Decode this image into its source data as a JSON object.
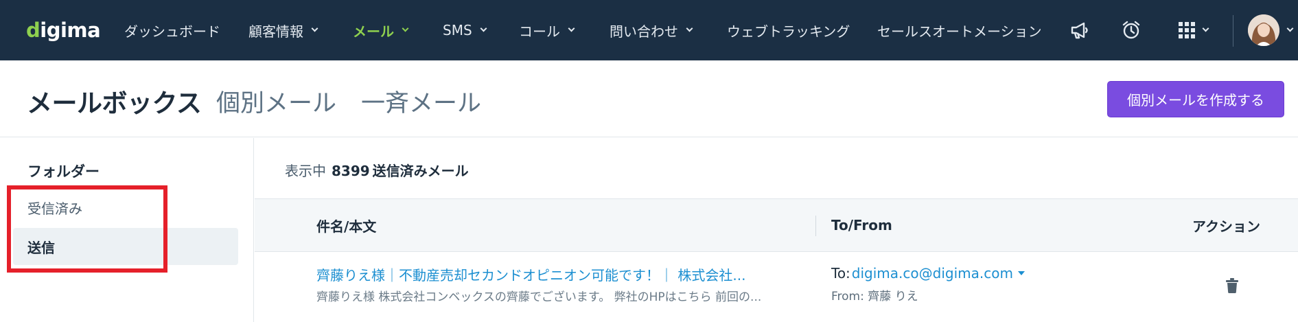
{
  "app": {
    "logo_text": "digima",
    "brand_color": "#8fd14f",
    "nav_background": "#1b2f44"
  },
  "nav": {
    "items": [
      {
        "label": "ダッシュボード",
        "has_dropdown": false,
        "active": false
      },
      {
        "label": "顧客情報",
        "has_dropdown": true,
        "active": false
      },
      {
        "label": "メール",
        "has_dropdown": true,
        "active": true
      },
      {
        "label": "SMS",
        "has_dropdown": true,
        "active": false
      },
      {
        "label": "コール",
        "has_dropdown": true,
        "active": false
      },
      {
        "label": "問い合わせ",
        "has_dropdown": true,
        "active": false
      },
      {
        "label": "ウェブトラッキング",
        "has_dropdown": false,
        "active": false
      },
      {
        "label": "セールスオートメーション",
        "has_dropdown": false,
        "active": false
      }
    ],
    "icons": [
      "megaphone-icon",
      "alarm-clock-icon",
      "apps-grid-icon",
      "user-avatar"
    ]
  },
  "header": {
    "title": "メールボックス",
    "tabs": [
      "個別メール",
      "一斉メール"
    ],
    "compose_button": "個別メールを作成する",
    "compose_button_color": "#7a4ce0"
  },
  "sidebar": {
    "heading": "フォルダー",
    "folders": [
      {
        "label": "受信済み",
        "selected": false
      },
      {
        "label": "送信",
        "selected": true
      }
    ],
    "highlight_color": "#e5202a"
  },
  "list": {
    "count_prefix": "表示中",
    "count": "8399",
    "count_label": "送信済みメール",
    "columns": [
      "件名/本文",
      "To/From",
      "アクション"
    ],
    "rows": [
      {
        "subject": "齊藤りえ様｜不動産売却セカンドオピニオン可能です！｜ 株式会社...",
        "snippet": "齊藤りえ様 株式会社コンベックスの齊藤でございます。 弊社のHPはこちら 前回の...",
        "to_prefix": "To:",
        "to": "digima.co@digima.com",
        "from": "From: 齊藤 りえ",
        "action_icon": "trash-icon"
      }
    ]
  },
  "link_color": "#1c8fd1"
}
